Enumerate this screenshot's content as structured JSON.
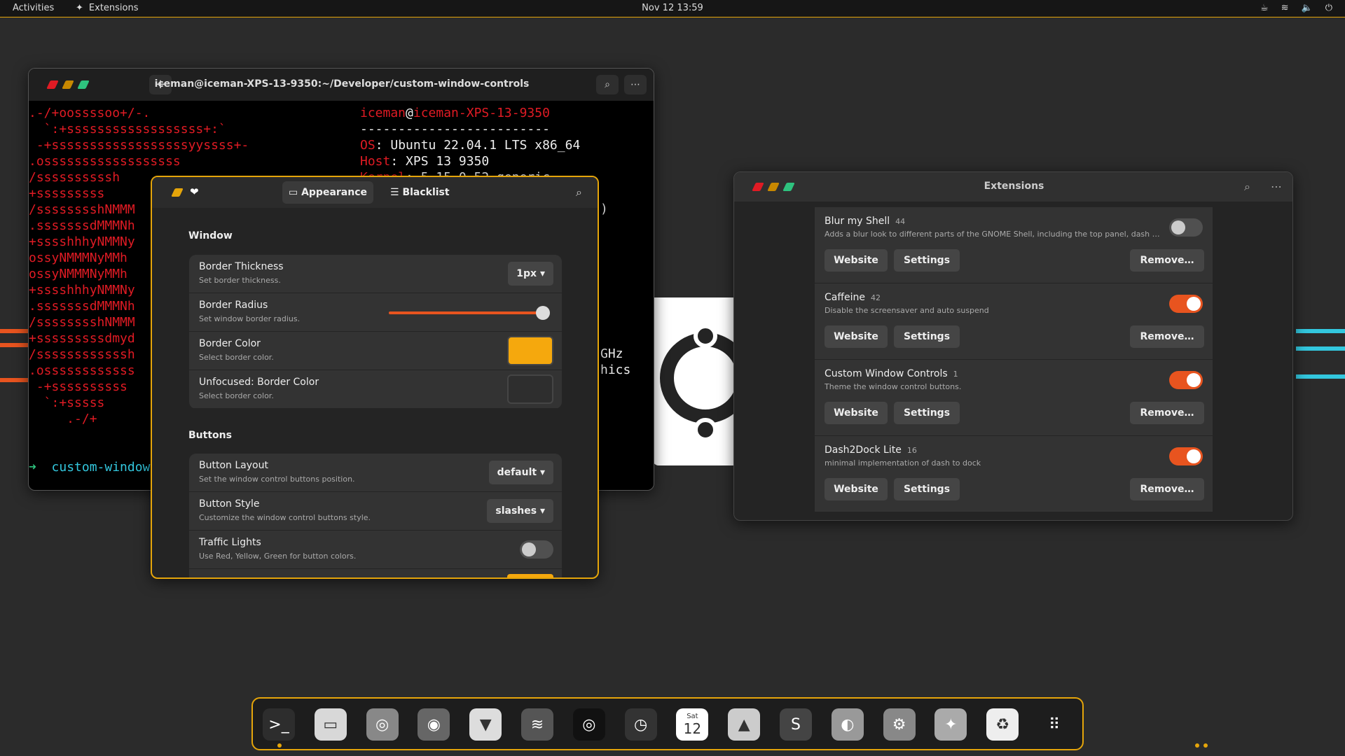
{
  "topbar": {
    "activities": "Activities",
    "app_name": "Extensions",
    "datetime": "Nov 12  13:59"
  },
  "terminal": {
    "title": "iceman@iceman-XPS-13-9350:~/Developer/custom-window-controls",
    "logo_red": [
      ".-/+oossssoo+/-.",
      "  `:+ssssssssssssssssss+:`",
      " -+ssssssssssssssssssyyssss+-",
      ".ossssssssssssssssss",
      "/ssssssssssh",
      "+sssssssss",
      "/sssssssshNMMM",
      ".sssssssdMMMNh",
      "+sssshhhyNMMNy",
      "ossyNMMMNyMMh",
      "ossyNMMMNyMMh",
      "+sssshhhyNMMNy",
      ".sssssssdMMMNh",
      "/sssssssshNMMM",
      "+sssssssssdmyd",
      "/ssssssssssssh",
      ".ossssssssssss",
      " -+ssssssssss",
      "  `:+sssss",
      "     .-/+"
    ],
    "user": "iceman",
    "at": "@",
    "host": "iceman-XPS-13-9350",
    "dashes": "-------------------------",
    "info": [
      {
        "k": "OS",
        "v": ": Ubuntu 22.04.1 LTS x86_64"
      },
      {
        "k": "Host",
        "v": ": XPS 13 9350"
      },
      {
        "k": "Kernel",
        "v": ": 5.15.0-52-generic"
      }
    ],
    "partial_ghz": "GHz",
    "partial_hics": "hics",
    "partial_paren": ")",
    "prompt": "custom-window"
  },
  "prefs": {
    "tabs": [
      {
        "label": "Appearance"
      },
      {
        "label": "Blacklist"
      }
    ],
    "window_section": "Window",
    "buttons_section": "Buttons",
    "window_rows": [
      {
        "title": "Border Thickness",
        "sub": "Set border thickness.",
        "value": "1px"
      },
      {
        "title": "Border Radius",
        "sub": "Set window border radius.",
        "slider": 1.0
      },
      {
        "title": "Border Color",
        "sub": "Select border color.",
        "color": "#f5a80d"
      },
      {
        "title": "Unfocused: Border Color",
        "sub": "Select border color.",
        "color": "#2e2e2e"
      }
    ],
    "button_rows": [
      {
        "title": "Button Layout",
        "sub": "Set the window control buttons position.",
        "value": "default"
      },
      {
        "title": "Button Style",
        "sub": "Customize the window control buttons style.",
        "value": "slashes"
      },
      {
        "title": "Traffic Lights",
        "sub": "Use Red, Yellow, Green for button colors.",
        "toggle": false
      }
    ]
  },
  "extensions": {
    "title": "Extensions",
    "website": "Website",
    "settings": "Settings",
    "remove": "Remove…",
    "items": [
      {
        "name": "Blur my Shell",
        "version": "44",
        "desc": "Adds a blur look to different parts of the GNOME Shell, including the top panel, dash a...",
        "enabled": false
      },
      {
        "name": "Caffeine",
        "version": "42",
        "desc": "Disable the screensaver and auto suspend",
        "enabled": true
      },
      {
        "name": "Custom Window Controls",
        "version": "1",
        "desc": "Theme the window control buttons.",
        "enabled": true
      },
      {
        "name": "Dash2Dock Lite",
        "version": "16",
        "desc": "minimal implementation of dash to dock",
        "enabled": true
      }
    ]
  },
  "dock": {
    "apps": [
      "terminal-icon",
      "files-icon",
      "screenshot-icon",
      "firefox-icon",
      "brave-icon",
      "spotify-icon",
      "obs-icon",
      "clock-icon",
      "calendar-icon",
      "vlc-icon",
      "sublime-icon",
      "tweaks-icon",
      "settings-icon",
      "extensions-icon",
      "trash-icon",
      "app-grid-icon"
    ],
    "calendar_day": "Sat",
    "calendar_num": "12"
  },
  "colors": {
    "accent": "#e5a50a",
    "toggle_on": "#e8541f",
    "close": "#e01b24",
    "minimize": "#c88800",
    "maximize": "#2ec27e"
  }
}
